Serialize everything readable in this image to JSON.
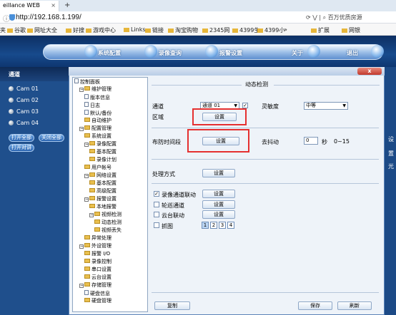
{
  "browser": {
    "tab_title": "eillance WEB",
    "tab_close": "×",
    "new_tab": "+",
    "url": "http://192.168.1.199/",
    "right_text": "百万优质房源"
  },
  "bookmarks": [
    "夹",
    "谷歌",
    "网址大全",
    "好搜",
    "游戏中心",
    "Links",
    "链接",
    "淘宝购物",
    "2345网",
    "4399生",
    "4399小",
    "»",
    "扩展",
    "网银"
  ],
  "app_menu": [
    "系统配置",
    "录像查询",
    "报警设置",
    "关于",
    "退出"
  ],
  "left_panel": {
    "header": "通道",
    "cams": [
      "Cam 01",
      "Cam 02",
      "Cam 03",
      "Cam 04"
    ],
    "buttons": [
      "打开全部",
      "关闭全部",
      "打开对讲"
    ]
  },
  "right_chars": [
    "设",
    "置",
    "光"
  ],
  "dialog": {
    "title": "控制面板",
    "close": "x"
  },
  "tree": [
    {
      "label": "控制面板",
      "kind": "page",
      "depth": 0
    },
    {
      "label": "维护管理",
      "kind": "minus",
      "depth": 1
    },
    {
      "label": "版本信息",
      "kind": "page",
      "depth": 2
    },
    {
      "label": "日志",
      "kind": "page",
      "depth": 2
    },
    {
      "label": "默认/备份",
      "kind": "page",
      "depth": 2
    },
    {
      "label": "自动维护",
      "kind": "folder",
      "depth": 2
    },
    {
      "label": "配置管理",
      "kind": "minus",
      "depth": 1
    },
    {
      "label": "系统设置",
      "kind": "folder",
      "depth": 2
    },
    {
      "label": "录像配置",
      "kind": "minus",
      "depth": 2
    },
    {
      "label": "基本配置",
      "kind": "folder",
      "depth": 3
    },
    {
      "label": "录像计划",
      "kind": "folder",
      "depth": 3
    },
    {
      "label": "用户帐号",
      "kind": "folder",
      "depth": 2
    },
    {
      "label": "网络设置",
      "kind": "minus",
      "depth": 2
    },
    {
      "label": "基本配置",
      "kind": "folder",
      "depth": 3
    },
    {
      "label": "高级配置",
      "kind": "folder",
      "depth": 3
    },
    {
      "label": "报警设置",
      "kind": "minus",
      "depth": 2
    },
    {
      "label": "本地报警",
      "kind": "folder",
      "depth": 3
    },
    {
      "label": "视频检测",
      "kind": "minus",
      "depth": 3
    },
    {
      "label": "动态检测",
      "kind": "folder",
      "depth": 4
    },
    {
      "label": "视频丢失",
      "kind": "folder",
      "depth": 4
    },
    {
      "label": "异常处理",
      "kind": "folder",
      "depth": 2
    },
    {
      "label": "外设管理",
      "kind": "minus",
      "depth": 1
    },
    {
      "label": "报警 I/O",
      "kind": "folder",
      "depth": 2
    },
    {
      "label": "录像控制",
      "kind": "folder",
      "depth": 2
    },
    {
      "label": "串口设置",
      "kind": "folder",
      "depth": 2
    },
    {
      "label": "云台设置",
      "kind": "folder",
      "depth": 2
    },
    {
      "label": "存储管理",
      "kind": "minus",
      "depth": 1
    },
    {
      "label": "硬盘信息",
      "kind": "page",
      "depth": 2
    },
    {
      "label": "硬盘管理",
      "kind": "folder",
      "depth": 2
    }
  ],
  "content": {
    "section_title": "动态检测",
    "channel_label": "通道",
    "channel_value": "通道 01",
    "sensitivity_label": "灵敏度",
    "sensitivity_value": "中等",
    "region_label": "区域",
    "set_label": "设置",
    "schedule_label": "布防时间段",
    "debounce_label": "去抖动",
    "debounce_value": "0",
    "debounce_unit": "秒",
    "debounce_range": "0~15",
    "handle_label": "处理方式",
    "options": [
      {
        "label": "录像通道联动",
        "checked": true
      },
      {
        "label": "轮巡通道",
        "checked": false
      },
      {
        "label": "云台联动",
        "checked": false
      },
      {
        "label": "抓图",
        "checked": false
      }
    ],
    "snap_numbers": [
      "1",
      "2",
      "3",
      "4"
    ],
    "copy_button": "复制",
    "save_button": "保存",
    "refresh_button": "刷新"
  },
  "colors": {
    "highlight": "#e53030",
    "app_bg": "#1e4f86"
  }
}
